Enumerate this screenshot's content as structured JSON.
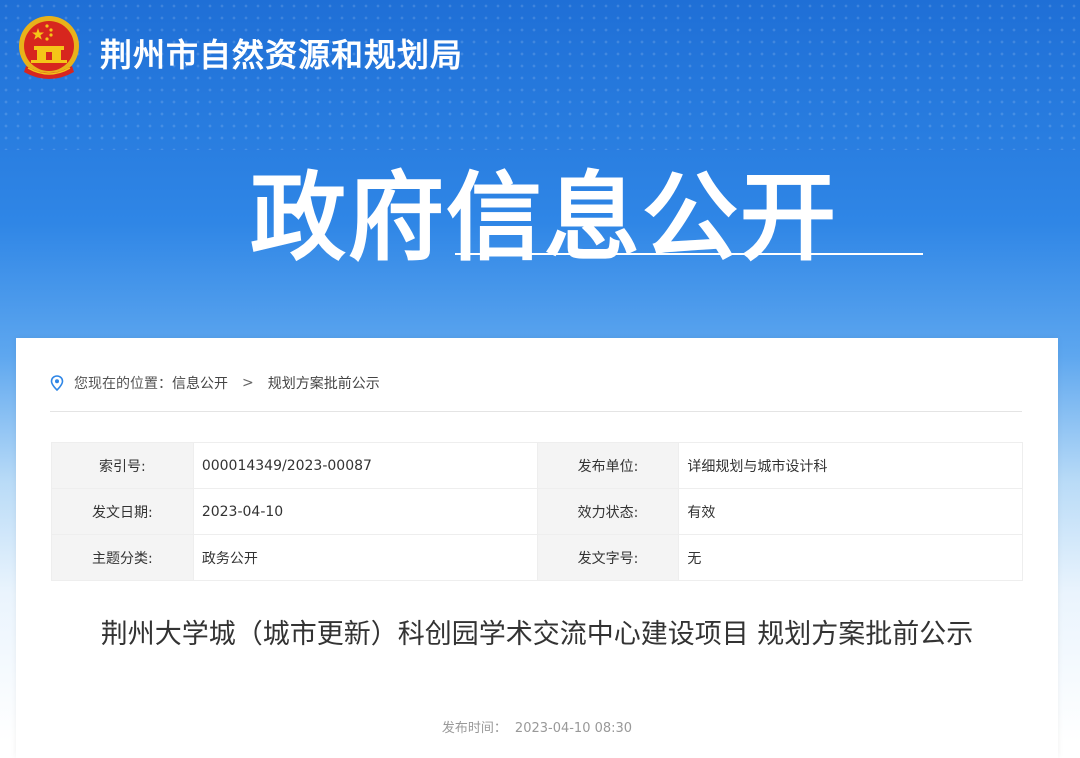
{
  "site": {
    "title": "荆州市自然资源和规划局",
    "banner_title": "政府信息公开"
  },
  "breadcrumb": {
    "prefix": "您现在的位置：",
    "items": [
      "信息公开",
      "规划方案批前公示"
    ],
    "separator": ">"
  },
  "meta_table": {
    "rows": [
      {
        "k1": "索引号:",
        "v1": "000014349/2023-00087",
        "k2": "发布单位:",
        "v2": "详细规划与城市设计科"
      },
      {
        "k1": "发文日期:",
        "v1": "2023-04-10",
        "k2": "效力状态:",
        "v2": "有效"
      },
      {
        "k1": "主题分类:",
        "v1": "政务公开",
        "k2": "发文字号:",
        "v2": "无"
      }
    ]
  },
  "article": {
    "title": "荆州大学城（城市更新）科创园学术交流中心建设项目 规划方案批前公示",
    "pub_label": "发布时间：",
    "pub_time": "2023-04-10 08:30"
  },
  "colors": {
    "header_blue": "#1f6fd6",
    "emblem_red": "#d7261e",
    "emblem_gold": "#f5c518",
    "pin_blue": "#2f86e6"
  },
  "icons": {
    "emblem": "national-emblem-icon",
    "location": "location-pin-icon"
  }
}
